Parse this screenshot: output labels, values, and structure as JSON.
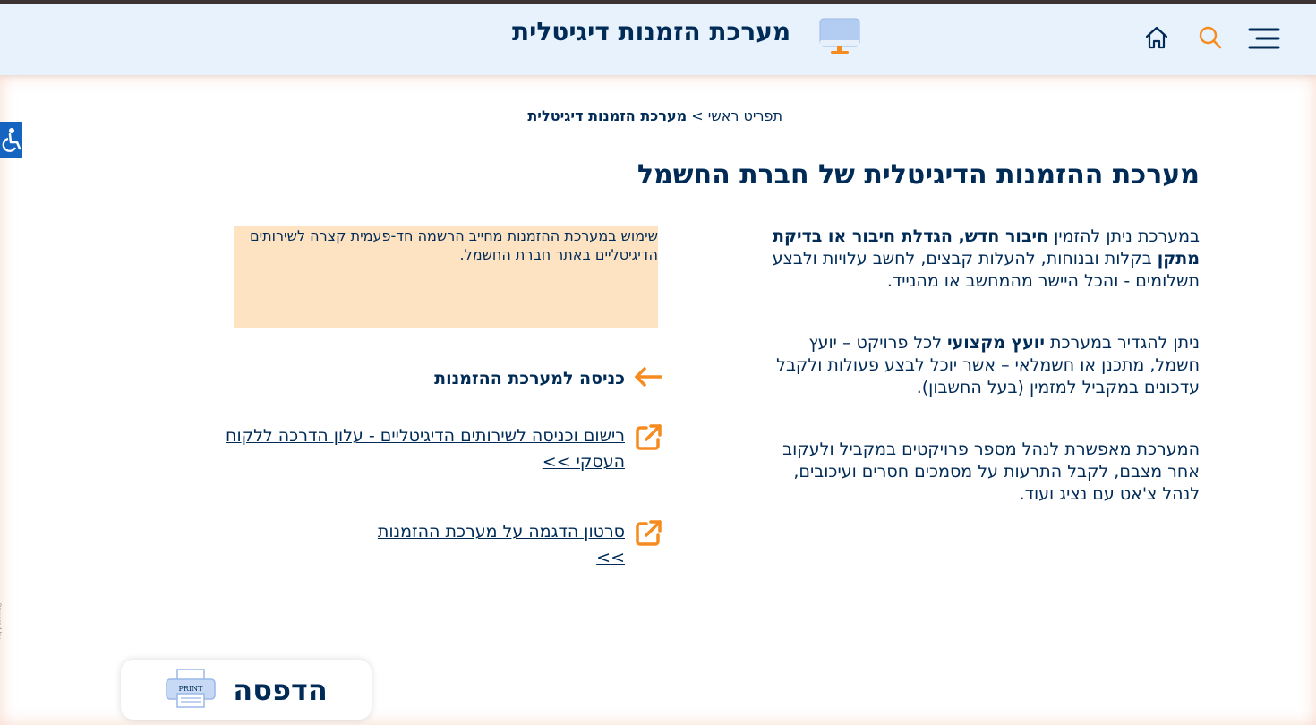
{
  "header": {
    "title": "מערכת הזמנות דיגיטלית",
    "icons": [
      "monitor-icon",
      "home-icon",
      "search-icon",
      "menu-icon"
    ]
  },
  "breadcrumb": {
    "home": "תפריט ראשי",
    "separator": ">",
    "current": "מערכת הזמנות דיגיטלית"
  },
  "page_title": "מערכת ההזמנות הדיגיטלית של חברת החשמל",
  "intro": {
    "p1": {
      "a": "במערכת ניתן להזמין ",
      "b1": "חיבור חדש, הגדלת חיבור או בדיקת מתקן",
      "c": " בקלות ובנוחות, להעלות קבצים, לחשב עלויות ולבצע תשלומים - והכל היישר מהמחשב או מהנייד."
    },
    "p2": {
      "a": "ניתן להגדיר במערכת ",
      "b1": "יועץ מקצועי",
      "c": " לכל פרויקט – יועץ חשמל, מתכנן או חשמלאי – אשר יוכל לבצע פעולות ולקבל עדכונים במקביל למזמין (בעל החשבון)."
    },
    "p3": "המערכת מאפשרת לנהל מספר פרויקטים במקביל ולעקוב אחר מצבם, לקבל התרעות על מסמכים חסרים ועיכובים, לנהל צ'אט עם נציג ועוד."
  },
  "notice": "שימוש במערכת ההזמנות מחייב הרשמה חד-פעמית קצרה לשירותים הדיגיטליים באתר חברת החשמל.",
  "links": {
    "enter": "כניסה למערכת ההזמנות",
    "guide": "רישום וכניסה לשירותים הדיגיטליים - עלון הדרכה ללקוח העסקי >>",
    "video": "סרטון הדגמה על מערכת ההזמנות >>"
  },
  "print": {
    "label": "הדפסה",
    "icon_text": "PRINT"
  },
  "colors": {
    "navy": "#002b57",
    "orange": "#f68b1f",
    "header_bg": "#e8f2fc",
    "notice_bg": "#fee3c3",
    "access_blue": "#1565c0"
  }
}
